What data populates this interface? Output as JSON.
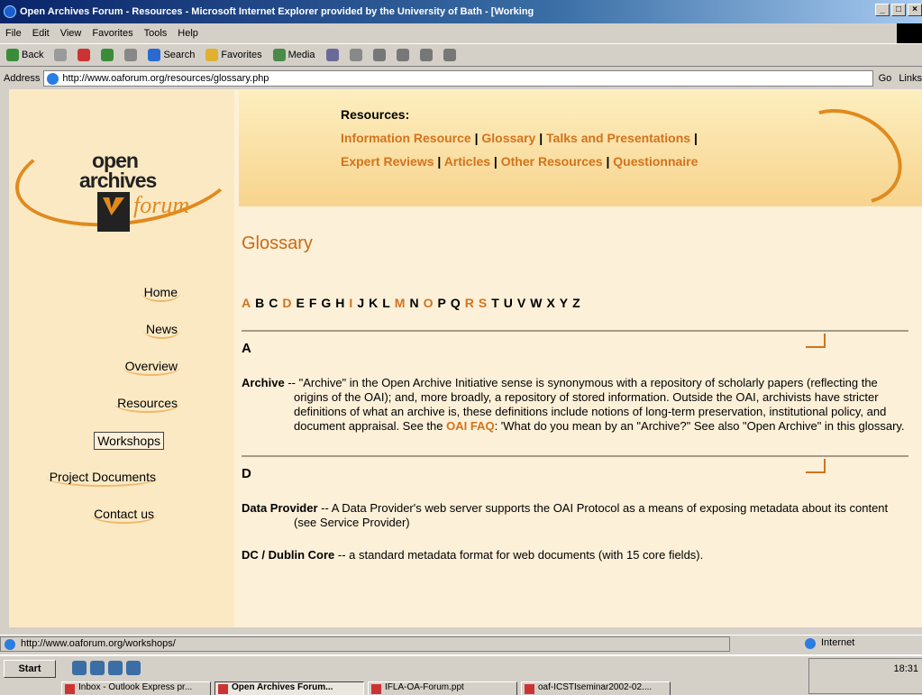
{
  "window": {
    "title": "Open Archives Forum - Resources - Microsoft Internet Explorer provided by the University of Bath - [Working",
    "controls": [
      "_",
      "□",
      "×"
    ]
  },
  "menu": [
    "File",
    "Edit",
    "View",
    "Favorites",
    "Tools",
    "Help"
  ],
  "toolbar": {
    "back": "Back",
    "search": "Search",
    "favorites": "Favorites",
    "media": "Media"
  },
  "address": {
    "label": "Address",
    "url": "http://www.oaforum.org/resources/glossary.php",
    "go": "Go",
    "links": "Links"
  },
  "logo": {
    "open": "open",
    "archives": "archives",
    "forum": "forum"
  },
  "resources": {
    "heading": "Resources:",
    "links": [
      "Information Resource",
      "Glossary",
      "Talks and Presentations",
      "Expert Reviews",
      "Articles",
      "Other Resources",
      "Questionnaire"
    ]
  },
  "nav": [
    "Home",
    "News",
    "Overview",
    "Resources",
    "Workshops",
    "Project Documents",
    "Contact us"
  ],
  "page": {
    "title": "Glossary",
    "letters": [
      "A",
      "B",
      "C",
      "D",
      "E",
      "F",
      "G",
      "H",
      "I",
      "J",
      "K",
      "L",
      "M",
      "N",
      "O",
      "P",
      "Q",
      "R",
      "S",
      "T",
      "U",
      "V",
      "W",
      "X",
      "Y",
      "Z"
    ],
    "active_letters": [
      "A",
      "D",
      "I",
      "M",
      "O",
      "R",
      "S"
    ]
  },
  "sections": [
    {
      "letter": "A",
      "entries": [
        {
          "term": "Archive",
          "text": " -- \"Archive\" in the Open Archive Initiative sense is synonymous with a repository of scholarly papers (reflecting the origins of the OAI); and, more broadly, a repository of stored information. Outside the OAI, archivists have stricter definitions of what an archive is, these definitions include notions of long-term preservation, institutional policy, and document appraisal. See the ",
          "link": "OAI FAQ",
          "tail": ": 'What do you mean by an \"Archive?\" See also \"Open Archive\" in this glossary."
        }
      ]
    },
    {
      "letter": "D",
      "entries": [
        {
          "term": "Data Provider",
          "text": " -- A Data Provider's web server supports the OAI Protocol as a means of exposing metadata about its content (see Service Provider)"
        },
        {
          "term": "DC / Dublin Core",
          "text": " -- a standard metadata format for web documents (with 15 core fields)."
        }
      ]
    }
  ],
  "status": {
    "url": "http://www.oaforum.org/workshops/",
    "zone": "Internet"
  },
  "taskbar": {
    "start": "Start",
    "tasks": [
      "Inbox - Outlook Express pr...",
      "Open Archives Forum...",
      "IFLA-OA-Forum.ppt",
      "oaf-ICSTIseminar2002-02...."
    ],
    "clock": "18:31"
  }
}
